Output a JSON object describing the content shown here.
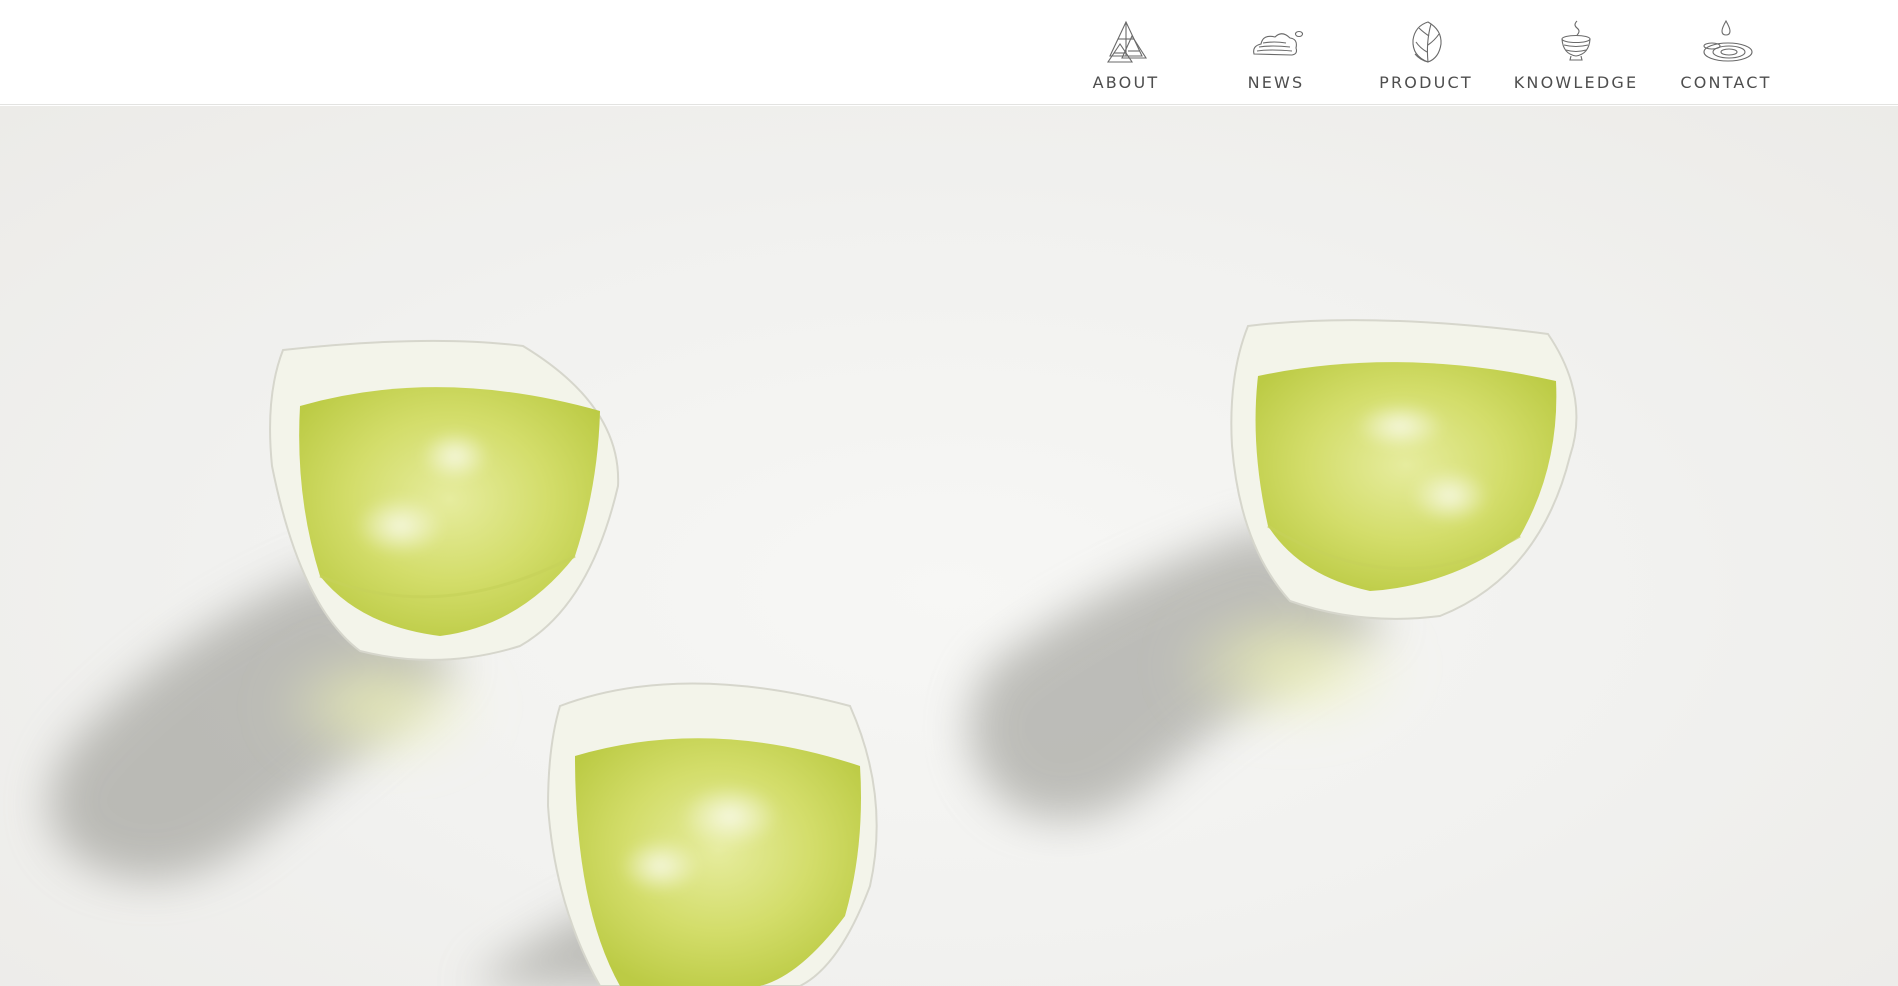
{
  "nav": {
    "items": [
      {
        "label": "ABOUT",
        "icon": "mountain-icon"
      },
      {
        "label": "NEWS",
        "icon": "cloud-icon"
      },
      {
        "label": "PRODUCT",
        "icon": "tea-leaf-icon"
      },
      {
        "label": "KNOWLEDGE",
        "icon": "tea-bowl-icon"
      },
      {
        "label": "CONTACT",
        "icon": "water-drop-icon"
      }
    ]
  },
  "hero": {
    "image": "hero-iced-green-tea-glasses"
  },
  "colors": {
    "nav_text": "#4e4e4e",
    "icon_stroke": "#6a6a6a",
    "hero_background": "#f1f1ef",
    "tea_green": "#d3dd6a"
  }
}
